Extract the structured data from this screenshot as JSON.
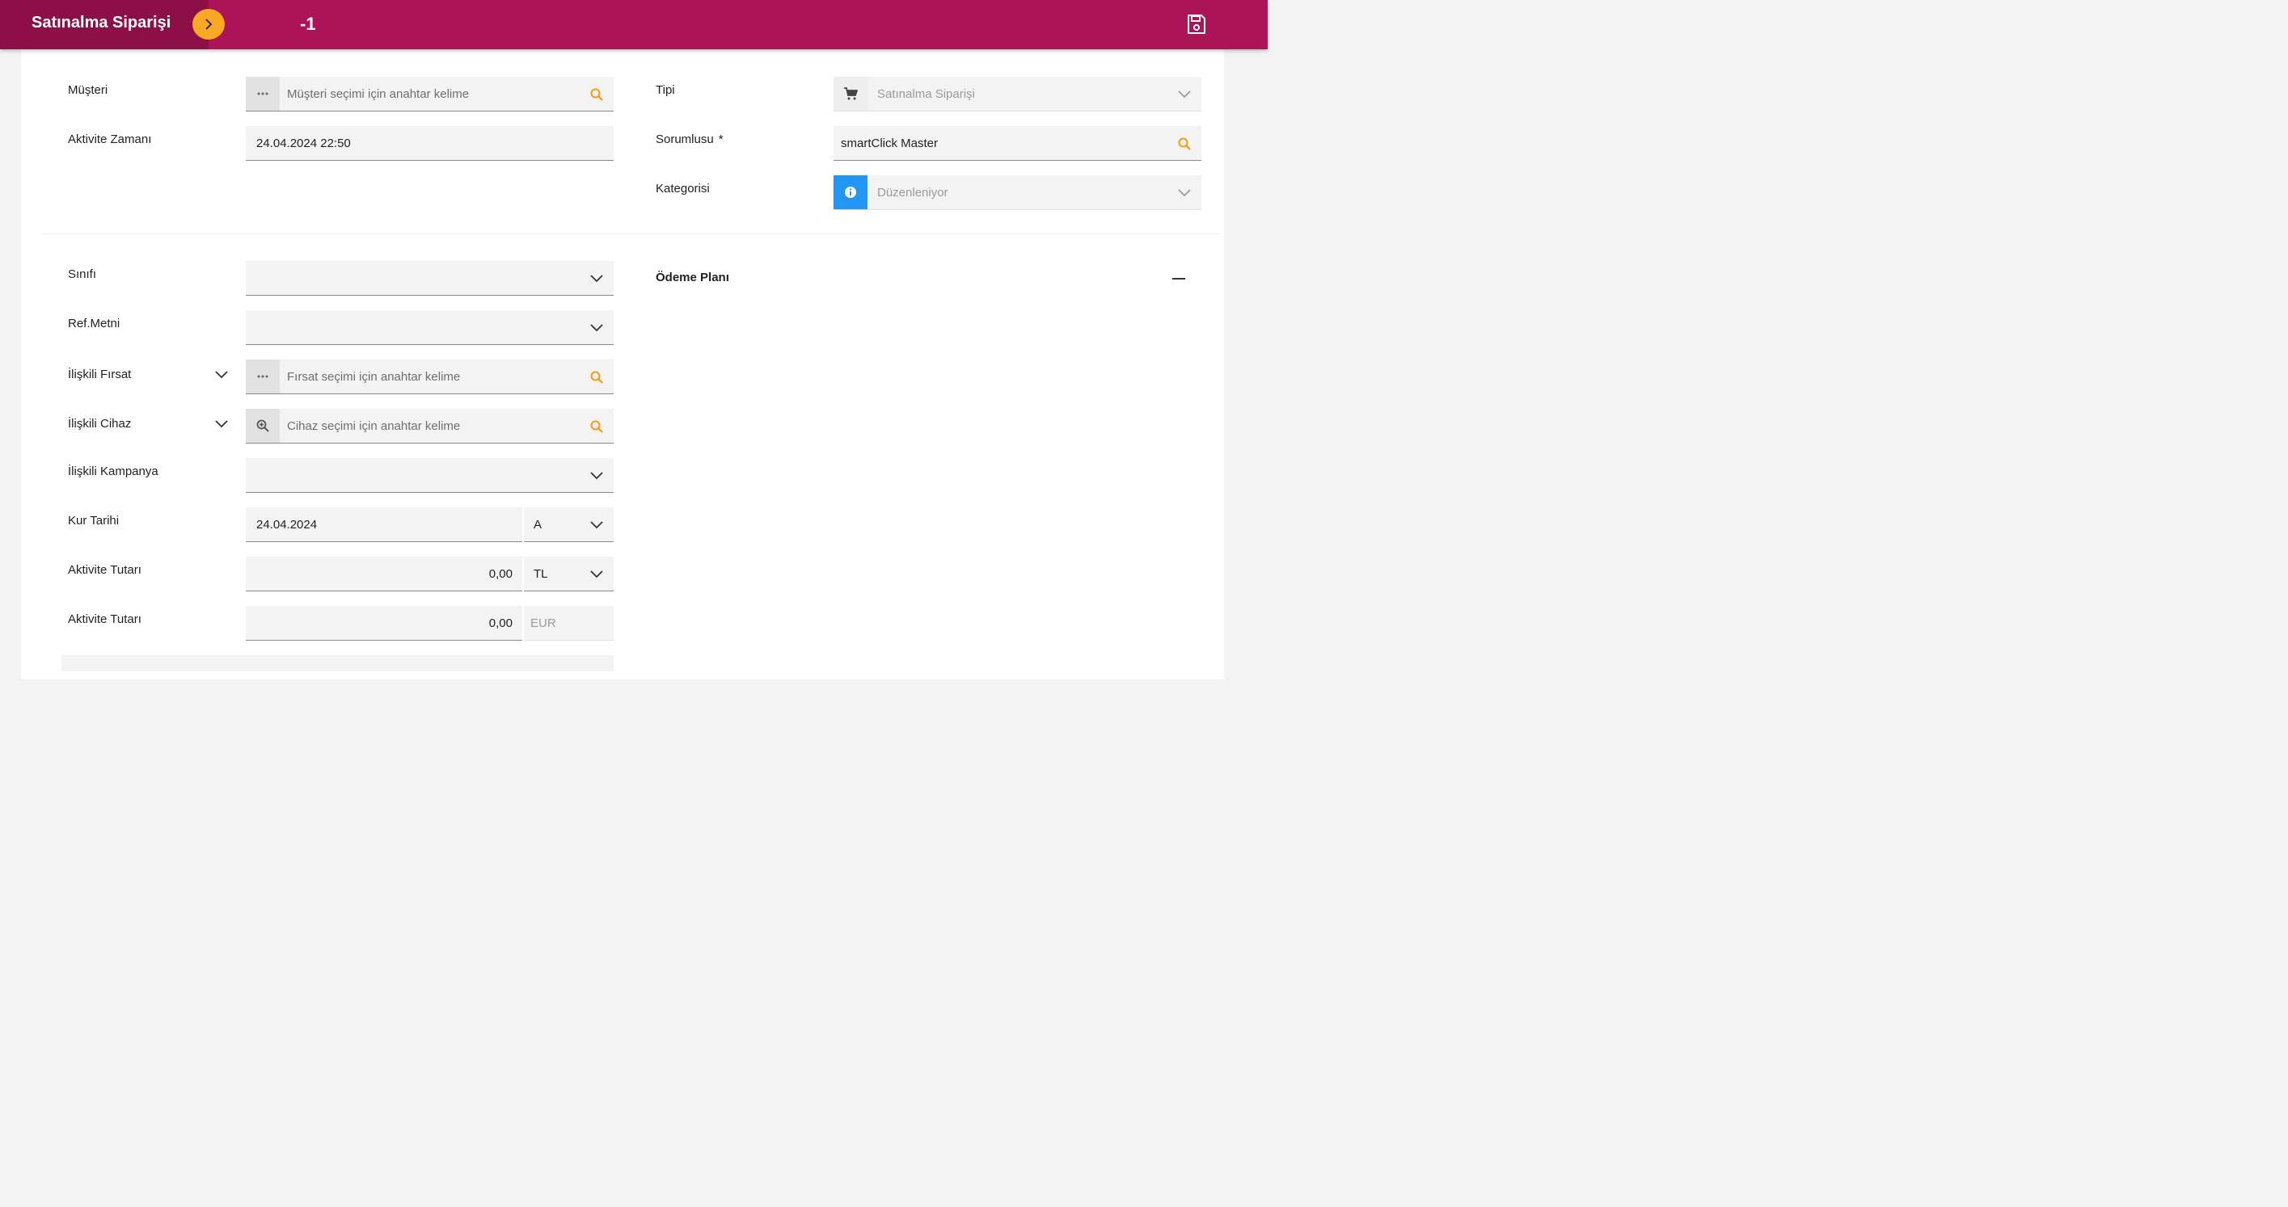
{
  "header": {
    "title": "Satınalma Siparişi",
    "record_no": "-1",
    "toggle_icon": "chevron-right-icon",
    "save_icon": "floppy-disk-icon"
  },
  "colors": {
    "header_bg": "#ad1457",
    "header_title_bg": "#8c1047",
    "toggle_bg": "#f9a825",
    "search_icon": "#f39c12",
    "info_prefix": "#2196f3"
  },
  "form_left_top": {
    "musteri": {
      "label": "Müşteri",
      "placeholder": "Müşteri seçimi için anahtar kelime"
    },
    "aktivite_zamani": {
      "label": "Aktivite Zamanı",
      "value": "24.04.2024 22:50"
    }
  },
  "form_right_top": {
    "tipi": {
      "label": "Tipi",
      "value": "Satınalma Siparişi"
    },
    "sorumlusu": {
      "label": "Sorumlusu",
      "required_mark": "*",
      "value": "smartClick Master"
    },
    "kategorisi": {
      "label": "Kategorisi",
      "value": "Düzenleniyor"
    }
  },
  "form_left_bottom": {
    "sinifi": {
      "label": "Sınıfı",
      "value": ""
    },
    "ref_metni": {
      "label": "Ref.Metni",
      "value": ""
    },
    "iliskili_firsat": {
      "label": "İlişkili Fırsat",
      "placeholder": "Fırsat seçimi için anahtar kelime"
    },
    "iliskili_cihaz": {
      "label": "İlişkili Cihaz",
      "placeholder": "Cihaz seçimi için anahtar kelime"
    },
    "iliskili_kampanya": {
      "label": "İlişkili Kampanya",
      "value": ""
    },
    "kur_tarihi": {
      "label": "Kur Tarihi",
      "value": "24.04.2024",
      "type_value": "A"
    },
    "aktivite_tutari_1": {
      "label": "Aktivite Tutarı",
      "value": "0,00",
      "currency": "TL"
    },
    "aktivite_tutari_2": {
      "label": "Aktivite Tutarı",
      "value": "0,00",
      "currency": "EUR"
    }
  },
  "odeme_plani": {
    "label": "Ödeme Planı"
  }
}
